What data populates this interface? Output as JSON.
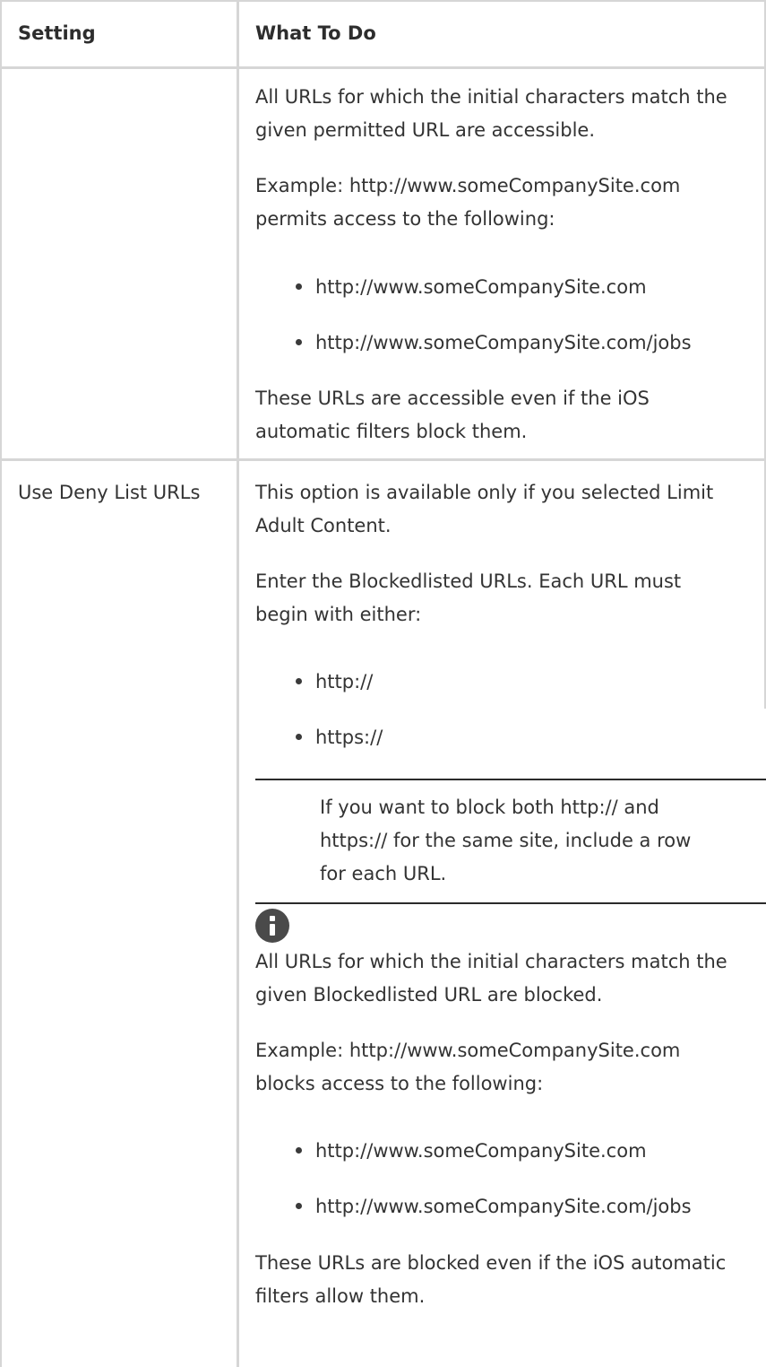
{
  "header": {
    "setting": "Setting",
    "what_to_do": "What To Do"
  },
  "row1": {
    "p1_line1": "All URLs for which the initial characters match the",
    "p1_line2": "given permitted URL are accessible.",
    "p2_line1": "Example: http://www.someCompanySite.com",
    "p2_line2": "permits access to the following:",
    "bullets": [
      "http://www.someCompanySite.com",
      "http://www.someCompanySite.com/jobs"
    ],
    "p3_line1": "These URLs are accessible even if the iOS",
    "p3_line2": "automatic filters block them."
  },
  "row2": {
    "setting": "Use Deny List URLs",
    "p1_line1": "This option is available only if you selected Limit",
    "p1_line2": "Adult Content.",
    "p2_line1": "Enter the Blockedlisted URLs. Each URL must",
    "p2_line2": "begin with either:",
    "bullets_a": [
      "http://",
      "https://"
    ],
    "note_line1": "If you want to block both http:// and",
    "note_line2": "https:// for the same site, include a row",
    "note_line3": "for each URL.",
    "p3_line1": "All URLs for which the initial characters match the",
    "p3_line2": "given Blockedlisted URL are blocked.",
    "p4_line1": "Example: http://www.someCompanySite.com",
    "p4_line2": "blocks access to the following:",
    "bullets_b": [
      "http://www.someCompanySite.com",
      "http://www.someCompanySite.com/jobs"
    ],
    "p5_line1": "These URLs are blocked even if the iOS automatic",
    "p5_line2": "filters allow them."
  },
  "icons": {
    "note": "info-icon"
  },
  "colors": {
    "border": "#d6d6d6",
    "text": "#333333",
    "icon": "#4a4a4a"
  }
}
